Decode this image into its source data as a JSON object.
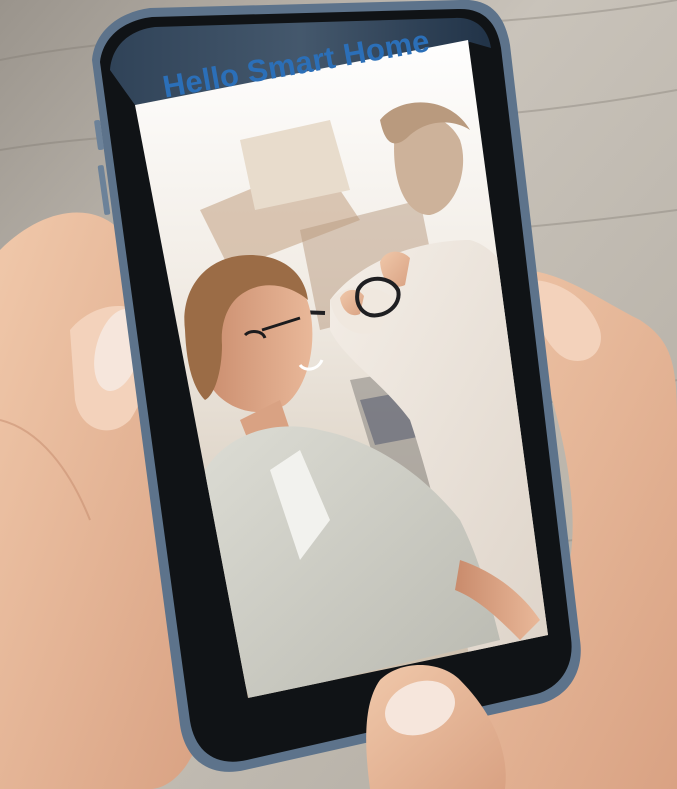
{
  "screen": {
    "headline": "Hello Smart Home"
  },
  "colors": {
    "headline_text": "#2b6fb8",
    "phone_body": "#111418",
    "phone_frame": "#5a6f86",
    "background_wood": "#b8b2a8"
  },
  "scene": {
    "description_icons": [
      "photo-couple",
      "hands",
      "phone"
    ]
  }
}
